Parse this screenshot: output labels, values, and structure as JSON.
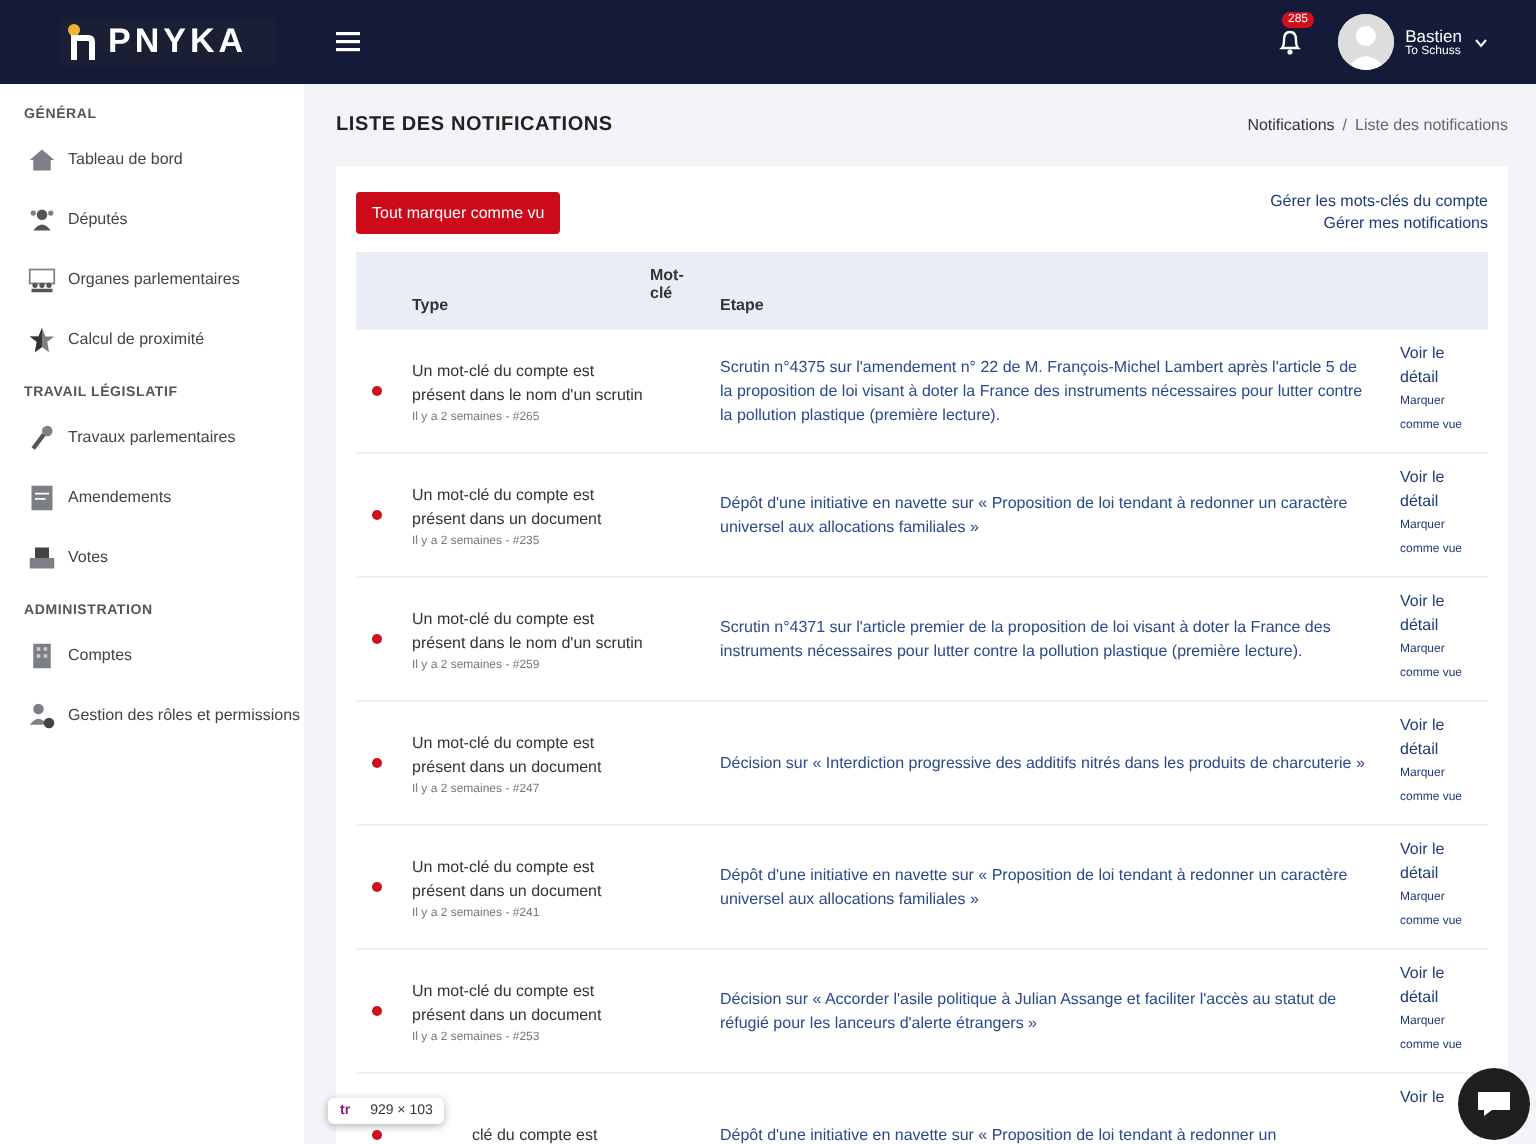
{
  "topbar": {
    "logo": "PNYKA",
    "notification_count": "285",
    "user": {
      "name": "Bastien",
      "subtitle": "To Schuss"
    }
  },
  "sidebar": {
    "sections": [
      {
        "title": "GÉNÉRAL",
        "items": [
          {
            "label": "Tableau de bord"
          },
          {
            "label": "Députés"
          },
          {
            "label": "Organes parlementaires"
          },
          {
            "label": "Calcul de proximité"
          }
        ]
      },
      {
        "title": "TRAVAIL LÉGISLATIF",
        "items": [
          {
            "label": "Travaux parlementaires"
          },
          {
            "label": "Amendements"
          },
          {
            "label": "Votes"
          }
        ]
      },
      {
        "title": "ADMINISTRATION",
        "items": [
          {
            "label": "Comptes"
          },
          {
            "label": "Gestion des rôles et permissions"
          }
        ]
      }
    ]
  },
  "page": {
    "title": "LISTE DES NOTIFICATIONS",
    "breadcrumb": [
      "Notifications",
      "Liste des notifications"
    ],
    "breadcrumb_separator": "/"
  },
  "actions": {
    "mark_all": "Tout marquer comme vu",
    "links": [
      "Gérer les mots-clés du compte",
      "Gérer mes notifications"
    ]
  },
  "table": {
    "columns": [
      "Type",
      "Mot-clé",
      "Etape"
    ],
    "rows": [
      {
        "unread": true,
        "type": "Un mot-clé du compte est présent dans le nom d'un scrutin",
        "meta": "Il y a 2 semaines - #265",
        "etape": "Scrutin n°4375 sur l'amendement n° 22 de M. François-Michel Lambert après l'article 5 de la proposition de loi visant à doter la France des instruments nécessaires pour lutter contre la pollution plastique (première lecture).",
        "detail": "Voir le détail",
        "mark": "Marquer comme vue"
      },
      {
        "unread": true,
        "type": "Un mot-clé du compte est présent dans un document",
        "meta": "Il y a 2 semaines - #235",
        "etape": "Dépôt d'une initiative en navette sur « Proposition de loi tendant à redonner un caractère universel aux allocations familiales »",
        "detail": "Voir le détail",
        "mark": "Marquer comme vue"
      },
      {
        "unread": true,
        "type": "Un mot-clé du compte est présent dans le nom d'un scrutin",
        "meta": "Il y a 2 semaines - #259",
        "etape": "Scrutin n°4371 sur l'article premier de la proposition de loi visant à doter la France des instruments nécessaires pour lutter contre la pollution plastique (première lecture).",
        "detail": "Voir le détail",
        "mark": "Marquer comme vue"
      },
      {
        "unread": true,
        "type": "Un mot-clé du compte est présent dans un document",
        "meta": "Il y a 2 semaines - #247",
        "etape": "Décision sur « Interdiction progressive des additifs nitrés dans les produits de charcuterie »",
        "detail": "Voir le détail",
        "mark": "Marquer comme vue"
      },
      {
        "unread": true,
        "type": "Un mot-clé du compte est présent dans un document",
        "meta": "Il y a 2 semaines - #241",
        "etape": "Dépôt d'une initiative en navette sur « Proposition de loi tendant à redonner un caractère universel aux allocations familiales »",
        "detail": "Voir le détail",
        "mark": "Marquer comme vue"
      },
      {
        "unread": true,
        "type": "Un mot-clé du compte est présent dans un document",
        "meta": "Il y a 2 semaines - #253",
        "etape": "Décision sur « Accorder l'asile politique à Julian Assange et faciliter l'accès au statut de réfugié pour les lanceurs d'alerte étrangers »",
        "detail": "Voir le détail",
        "mark": "Marquer comme vue"
      },
      {
        "unread": true,
        "type": "clé du compte est",
        "etape": "Dépôt d'une initiative en navette sur « Proposition de loi tendant à redonner un",
        "detail": "Voir le"
      }
    ]
  },
  "inspector_tooltip": {
    "tag": "tr",
    "size": "929 × 103"
  }
}
